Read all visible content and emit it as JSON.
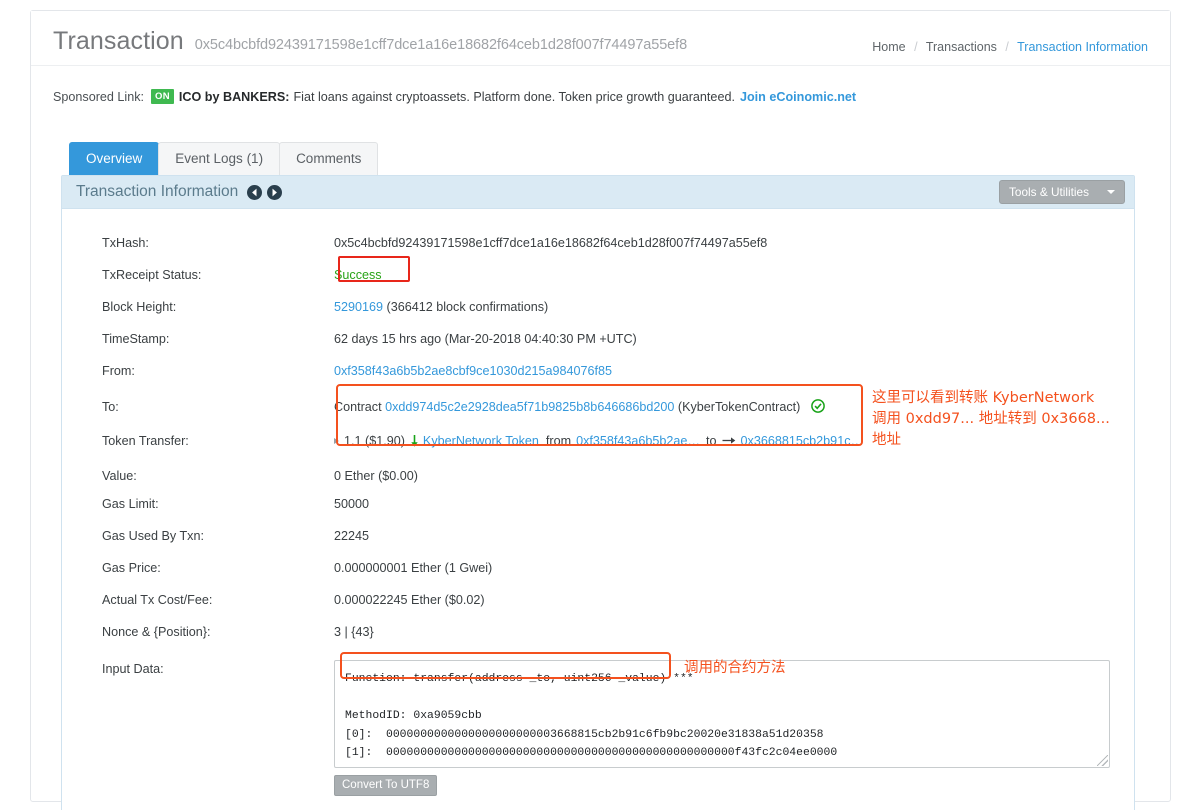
{
  "header": {
    "title": "Transaction",
    "hash": "0x5c4bcbfd92439171598e1cff7dce1a16e18682f64ceb1d28f007f74497a55ef8",
    "breadcrumb": {
      "home": "Home",
      "transactions": "Transactions",
      "current": "Transaction Information",
      "separator": "/"
    }
  },
  "sponsored": {
    "label": "Sponsored Link:",
    "badge": "ON",
    "advertiser": "ICO by BANKERS:",
    "text": "Fiat loans against cryptoassets. Platform done. Token price growth guaranteed.",
    "link": "Join eCoinomic.net"
  },
  "tabs": [
    {
      "label": "Overview",
      "active": true
    },
    {
      "label": "Event Logs (1)",
      "active": false
    },
    {
      "label": "Comments",
      "active": false
    }
  ],
  "panel": {
    "title": "Transaction Information",
    "tools_button": "Tools & Utilities"
  },
  "fields": {
    "txhash_label": "TxHash:",
    "txhash_value": "0x5c4bcbfd92439171598e1cff7dce1a16e18682f64ceb1d28f007f74497a55ef8",
    "status_label": "TxReceipt Status:",
    "status_value": "Success",
    "block_label": "Block Height:",
    "block_value": "5290169",
    "block_confirmations": "(366412 block confirmations)",
    "timestamp_label": "TimeStamp:",
    "timestamp_value": "62 days 15 hrs ago (Mar-20-2018 04:40:30 PM +UTC)",
    "from_label": "From:",
    "from_value": "0xf358f43a6b5b2ae8cbf9ce1030d215a984076f85",
    "to_label": "To:",
    "to_prefix": "Contract",
    "to_value": "0xdd974d5c2e2928dea5f71b9825b8b646686bd200",
    "to_suffix": "(KyberTokenContract)",
    "token_transfer_label": "Token Transfer:",
    "tt_amount": "1.1 ($1.90)",
    "tt_token": "KyberNetwork Token",
    "tt_from_word": "from",
    "tt_from": "0xf358f43a6b5b2ae…",
    "tt_to_word": "to",
    "tt_to": "0x3668815cb2b91c…",
    "value_label": "Value:",
    "value_value": "0 Ether ($0.00)",
    "gaslimit_label": "Gas Limit:",
    "gaslimit_value": "50000",
    "gasused_label": "Gas Used By Txn:",
    "gasused_value": "22245",
    "gasprice_label": "Gas Price:",
    "gasprice_value": "0.000000001 Ether (1 Gwei)",
    "txcost_label": "Actual Tx Cost/Fee:",
    "txcost_value": "0.000022245 Ether ($0.02)",
    "nonce_label": "Nonce & {Position}:",
    "nonce_value": "3 | {43}",
    "inputdata_label": "Input Data:",
    "inputdata_function": "Function: transfer(address _to, uint256 _value) ***",
    "inputdata_methodid": "MethodID: 0xa9059cbb",
    "inputdata_arg0": "[0]:  0000000000000000000000003668815cb2b91c6fb9bc20020e31838a51d20358",
    "inputdata_arg1": "[1]:  000000000000000000000000000000000000000000000000000f43fc2c04ee0000",
    "utf8_button": "Convert To UTF8"
  },
  "annotations": {
    "transfer_note": "这里可以看到转账 KyberNetwork\n调用 0xdd97... 地址转到 0x3668...\n地址",
    "function_note": "调用的合约方法"
  },
  "colors": {
    "link": "#3498db",
    "success": "#2aa318",
    "annotation": "#f4511e",
    "highlight_red": "#e8261a",
    "badge_green": "#3fb950",
    "panel_head": "#daeaf4"
  }
}
